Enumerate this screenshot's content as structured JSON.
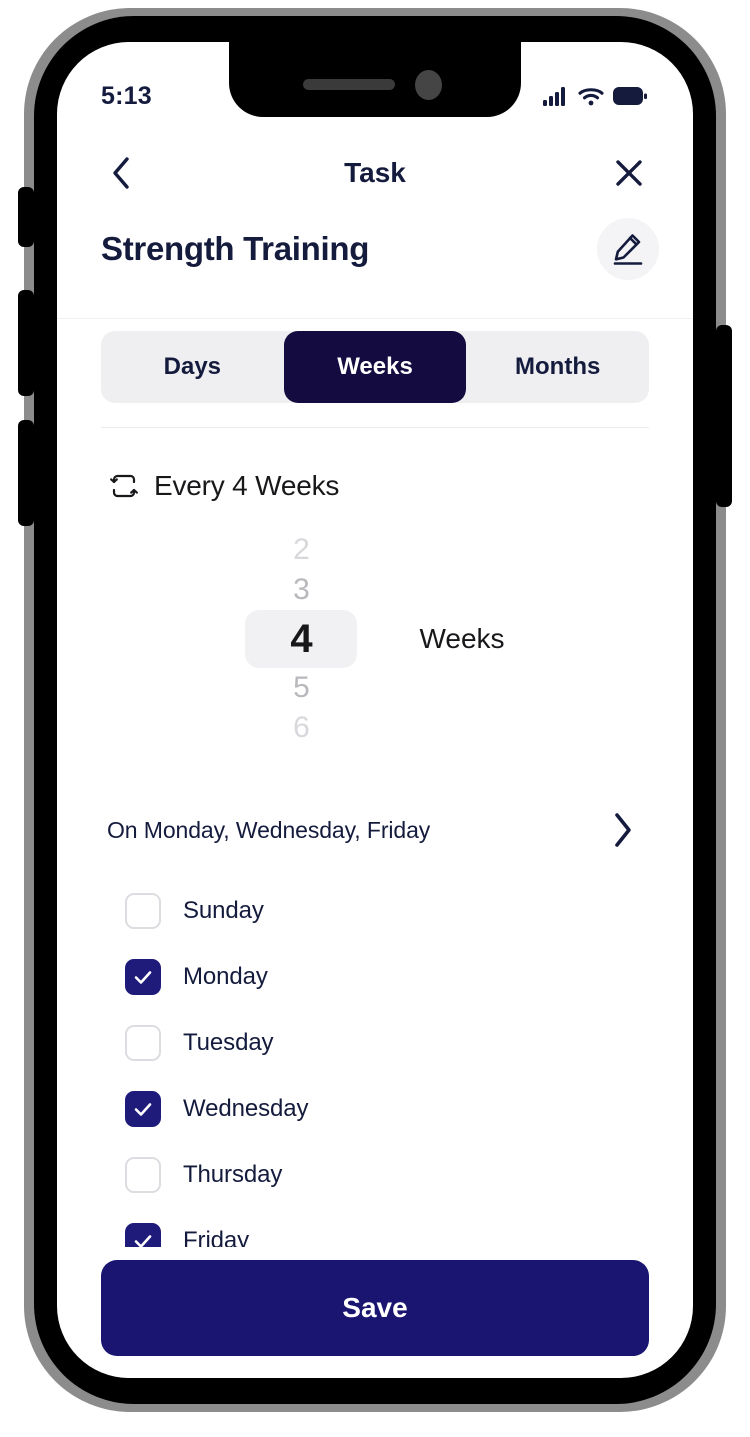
{
  "status_bar": {
    "time": "5:13",
    "signal_icon": "cellular-signal-icon",
    "wifi_icon": "wifi-icon",
    "battery_icon": "battery-full-icon"
  },
  "nav": {
    "back_icon": "chevron-left-icon",
    "title": "Task",
    "close_icon": "close-icon"
  },
  "task": {
    "name": "Strength Training",
    "edit_icon": "pencil-edit-icon"
  },
  "segmented": {
    "options": [
      {
        "label": "Days",
        "selected": false
      },
      {
        "label": "Weeks",
        "selected": true
      },
      {
        "label": "Months",
        "selected": false
      }
    ]
  },
  "frequency": {
    "repeat_icon": "repeat-icon",
    "summary": "Every 4 Weeks",
    "picker": {
      "values": [
        "2",
        "3",
        "4",
        "5",
        "6"
      ],
      "selected": "4",
      "unit": "Weeks"
    }
  },
  "on_days": {
    "summary": "On Monday, Wednesday, Friday",
    "chevron_icon": "chevron-right-icon"
  },
  "days": [
    {
      "label": "Sunday",
      "checked": false
    },
    {
      "label": "Monday",
      "checked": true
    },
    {
      "label": "Tuesday",
      "checked": false
    },
    {
      "label": "Wednesday",
      "checked": true
    },
    {
      "label": "Thursday",
      "checked": false
    },
    {
      "label": "Friday",
      "checked": true
    }
  ],
  "footer": {
    "save_label": "Save"
  },
  "colors": {
    "navy_dark": "#140C40",
    "navy_accent": "#1F1B7A",
    "navy_button": "#1A1570",
    "text": "#141B3D",
    "track": "#EFEFF1"
  }
}
